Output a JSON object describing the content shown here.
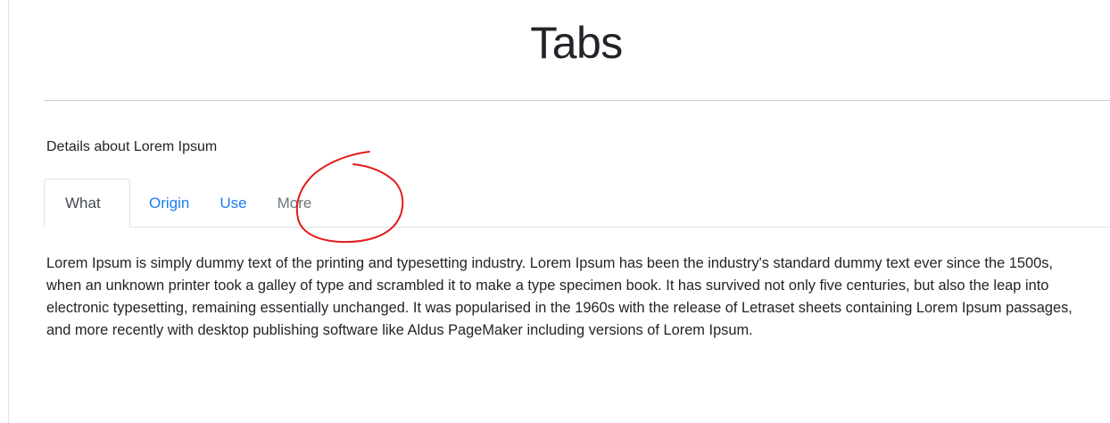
{
  "page": {
    "title": "Tabs",
    "caption": "Details about Lorem Ipsum"
  },
  "tabs": [
    {
      "label": "What",
      "state": "active"
    },
    {
      "label": "Origin",
      "state": "link"
    },
    {
      "label": "Use",
      "state": "link"
    },
    {
      "label": "More",
      "state": "disabled"
    }
  ],
  "content": {
    "text": "Lorem Ipsum is simply dummy text of the printing and typesetting industry. Lorem Ipsum has been the industry's standard dummy text ever since the 1500s, when an unknown printer took a galley of type and scrambled it to make a type specimen book. It has survived not only five centuries, but also the leap into electronic typesetting, remaining essentially unchanged. It was popularised in the 1960s with the release of Letraset sheets containing Lorem Ipsum passages, and more recently with desktop publishing software like Aldus PageMaker including versions of Lorem Ipsum."
  },
  "colors": {
    "link": "#1a7ef0",
    "annotation": "#e21b1b",
    "disabled": "#6c757d"
  }
}
